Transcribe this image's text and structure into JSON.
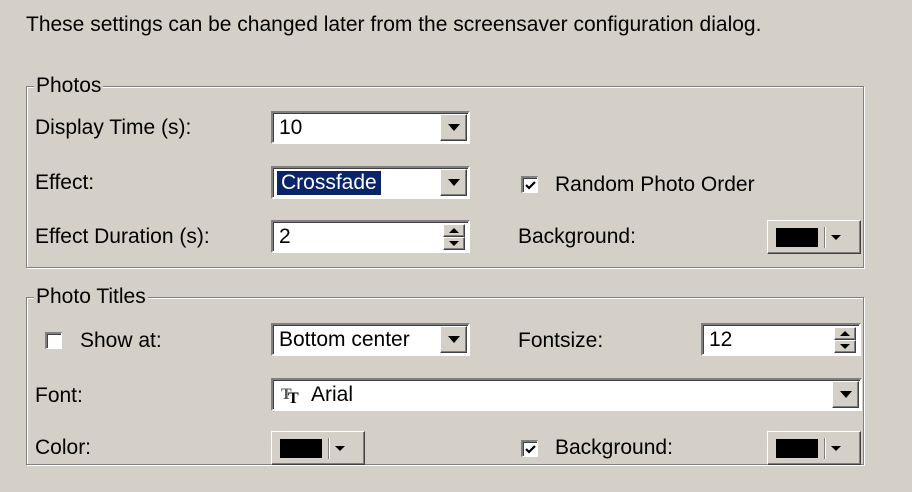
{
  "intro_text": "These settings can be changed later from the screensaver configuration dialog.",
  "photos": {
    "title": "Photos",
    "display_time": {
      "label": "Display Time (s):",
      "value": "10"
    },
    "effect": {
      "label": "Effect:",
      "value": "Crossfade"
    },
    "random_order": {
      "label": "Random Photo Order",
      "checked": true
    },
    "effect_duration": {
      "label": "Effect Duration (s):",
      "value": "2"
    },
    "background": {
      "label": "Background:",
      "color": "#000000"
    }
  },
  "photo_titles": {
    "title": "Photo Titles",
    "show_at": {
      "label": "Show at:",
      "checked": false,
      "value": "Bottom center"
    },
    "fontsize": {
      "label": "Fontsize:",
      "value": "12"
    },
    "font": {
      "label": "Font:",
      "value": "Arial",
      "icon": "truetype-font-icon"
    },
    "color": {
      "label": "Color:",
      "color": "#000000"
    },
    "background": {
      "label": "Background:",
      "checked": true,
      "color": "#000000"
    }
  }
}
